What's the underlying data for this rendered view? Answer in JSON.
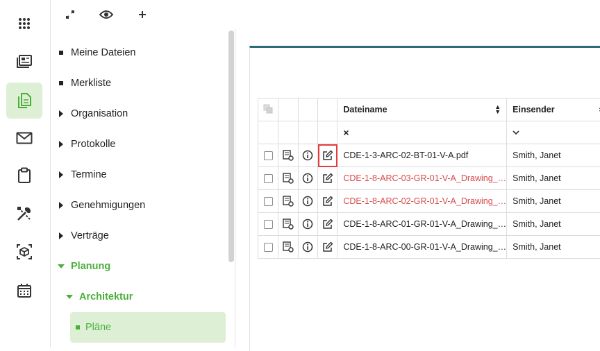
{
  "rail": {
    "items": [
      {
        "icon": "apps-grid-icon"
      },
      {
        "icon": "dashboard-icon"
      },
      {
        "icon": "documents-icon",
        "active": true
      },
      {
        "icon": "mail-icon"
      },
      {
        "icon": "clipboard-icon"
      },
      {
        "icon": "tools-icon"
      },
      {
        "icon": "3d-model-icon"
      },
      {
        "icon": "calendar-icon"
      }
    ],
    "active_color": "#ddf0d6"
  },
  "tree": {
    "toolbar": [
      "collapse-icon",
      "eye-icon",
      "plus-icon"
    ],
    "items": [
      {
        "label": "Meine Dateien",
        "marker": "square"
      },
      {
        "label": "Merkliste",
        "marker": "square"
      },
      {
        "label": "Organisation",
        "marker": "arrow-right"
      },
      {
        "label": "Protokolle",
        "marker": "arrow-right"
      },
      {
        "label": "Termine",
        "marker": "arrow-right"
      },
      {
        "label": "Genehmigungen",
        "marker": "arrow-right"
      },
      {
        "label": "Verträge",
        "marker": "arrow-right"
      },
      {
        "label": "Planung",
        "marker": "arrow-down",
        "expanded": true
      },
      {
        "label": "Architektur",
        "marker": "arrow-down",
        "expanded": true
      },
      {
        "label": "Pläne",
        "marker": "square",
        "selected": true
      }
    ],
    "accent": "#4caf3c"
  },
  "table": {
    "columns": {
      "name": "Dateiname",
      "sender": "Einsender"
    },
    "filter": {
      "name_clear": "×"
    },
    "rows": [
      {
        "name": "CDE-1-3-ARC-02-BT-01-V-A.pdf",
        "sender": "Smith, Janet",
        "red": false
      },
      {
        "name": "CDE-1-8-ARC-03-GR-01-V-A_Drawing_…",
        "sender": "Smith, Janet",
        "red": true
      },
      {
        "name": "CDE-1-8-ARC-02-GR-01-V-A_Drawing_…",
        "sender": "Smith, Janet",
        "red": true
      },
      {
        "name": "CDE-1-8-ARC-01-GR-01-V-A_Drawing_…",
        "sender": "Smith, Janet",
        "red": false
      },
      {
        "name": "CDE-1-8-ARC-00-GR-01-V-A_Drawing_…",
        "sender": "Smith, Janet",
        "red": false
      }
    ],
    "highlight_color": "#e23d3d",
    "red_text_color": "#d94a4a",
    "panel_border_color": "#2d6b7a"
  }
}
